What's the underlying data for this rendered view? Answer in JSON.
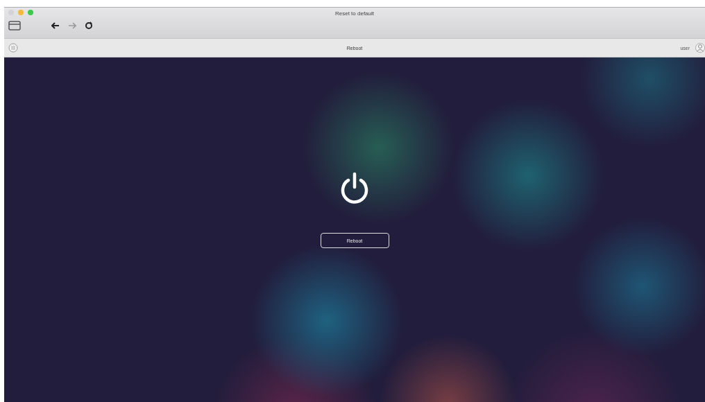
{
  "window": {
    "title": "Reset to default"
  },
  "toolbar": {
    "title": "Reboot",
    "user": "user"
  },
  "content": {
    "button": "Reboot"
  }
}
